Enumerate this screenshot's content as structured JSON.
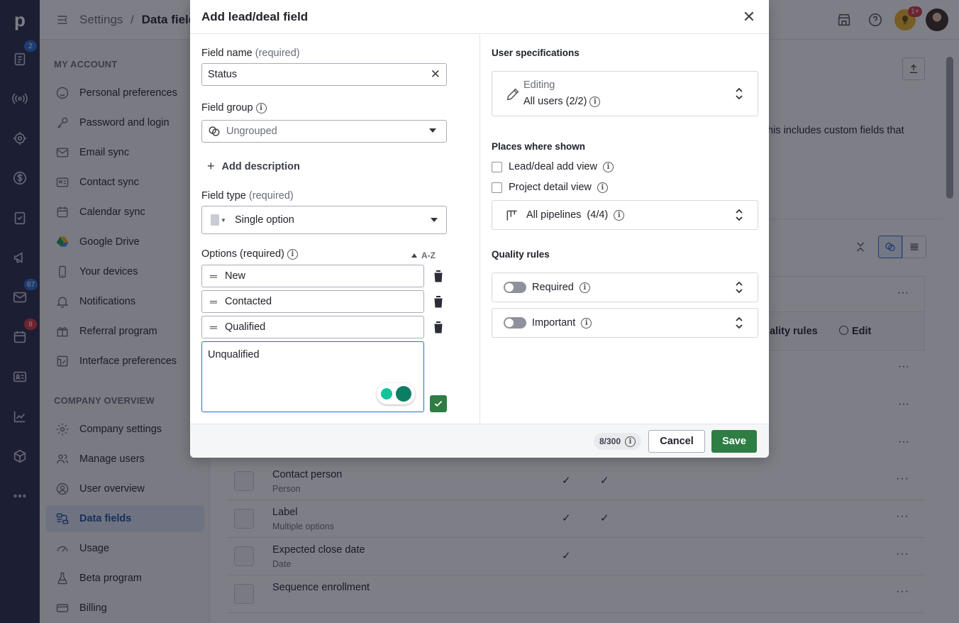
{
  "rail": {
    "logo": "p",
    "badges": {
      "deals": "2",
      "mail": "67",
      "calendar": "8"
    }
  },
  "topbar": {
    "breadcrumb_root": "Settings",
    "breadcrumb_sep": "/",
    "breadcrumb_current": "Data fields",
    "notif_badge": "1+"
  },
  "sidebar": {
    "my_account_title": "MY ACCOUNT",
    "my_account": [
      {
        "label": "Personal preferences",
        "icon": "smile-icon"
      },
      {
        "label": "Password and login",
        "icon": "key-icon"
      },
      {
        "label": "Email sync",
        "icon": "mail-icon"
      },
      {
        "label": "Contact sync",
        "icon": "contact-card-icon"
      },
      {
        "label": "Calendar sync",
        "icon": "calendar-icon"
      },
      {
        "label": "Google Drive",
        "icon": "google-drive-icon"
      },
      {
        "label": "Your devices",
        "icon": "phone-icon"
      },
      {
        "label": "Notifications",
        "icon": "bell-icon"
      },
      {
        "label": "Referral program",
        "icon": "gift-icon"
      },
      {
        "label": "Interface preferences",
        "icon": "interface-icon"
      }
    ],
    "company_title": "COMPANY OVERVIEW",
    "company": [
      {
        "label": "Company settings",
        "icon": "gear-icon"
      },
      {
        "label": "Manage users",
        "icon": "users-icon"
      },
      {
        "label": "User overview",
        "icon": "user-circle-icon"
      },
      {
        "label": "Data fields",
        "icon": "data-fields-icon",
        "active": true
      },
      {
        "label": "Usage",
        "icon": "gauge-icon"
      },
      {
        "label": "Beta program",
        "icon": "flask-icon"
      },
      {
        "label": "Billing",
        "icon": "card-icon"
      }
    ]
  },
  "background": {
    "partial_text": "his includes custom fields that",
    "col_quality_rules": "ality rules",
    "col_edit": "Edit",
    "rows": [
      {
        "name": "Contact person",
        "type": "Person",
        "check1": "✓",
        "check2": "✓"
      },
      {
        "name": "Label",
        "type": "Multiple options",
        "check1": "✓",
        "check2": "✓"
      },
      {
        "name": "Expected close date",
        "type": "Date",
        "check1": "✓",
        "check2": ""
      },
      {
        "name": "Sequence enrollment",
        "type": "",
        "check1": "",
        "check2": ""
      }
    ]
  },
  "modal": {
    "title": "Add lead/deal field",
    "field_name_label": "Field name",
    "required_suffix": "(required)",
    "field_name_value": "Status",
    "field_group_label": "Field group",
    "field_group_value": "Ungrouped",
    "add_description": "Add description",
    "field_type_label": "Field type",
    "field_type_value": "Single option",
    "options_label": "Options (required)",
    "sort_label": "A-Z",
    "options": [
      "New",
      "Contacted",
      "Qualified"
    ],
    "new_option_value": "Unqualified",
    "user_spec_title": "User specifications",
    "editing_label": "Editing",
    "editing_value": "All users (2/2)",
    "places_title": "Places where shown",
    "place_lead_deal": "Lead/deal add view",
    "place_project": "Project detail view",
    "pipelines_value": "All pipelines  (4/4)",
    "quality_title": "Quality rules",
    "required_rule": "Required",
    "important_rule": "Important",
    "char_count": "8/300",
    "cancel": "Cancel",
    "save": "Save"
  },
  "colors": {
    "rail": "#26294a",
    "save": "#2e7d43",
    "active": "#dde5f3"
  }
}
